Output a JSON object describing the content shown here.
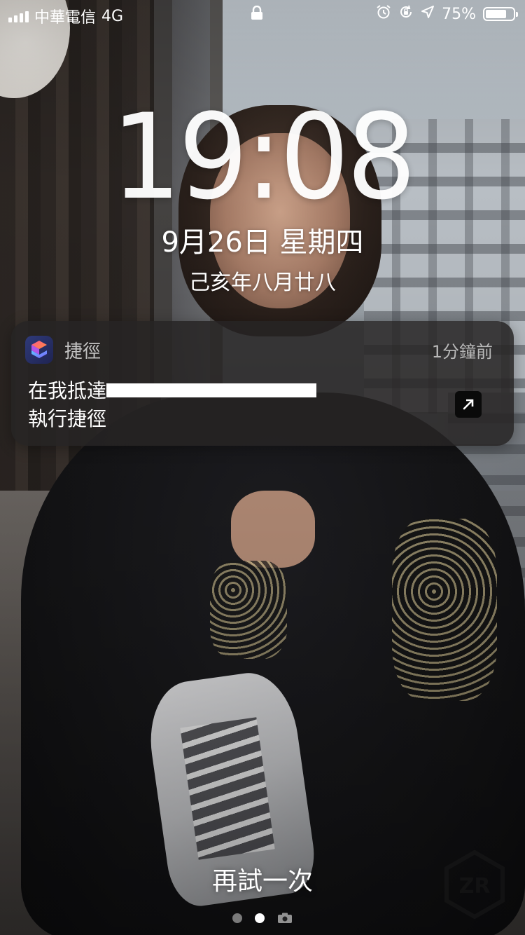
{
  "status_bar": {
    "carrier": "中華電信",
    "network": "4G",
    "battery_percent_label": "75%",
    "battery_level": 0.75,
    "icons": [
      "signal-icon",
      "lock-icon",
      "alarm-icon",
      "rotation-lock-icon",
      "location-icon",
      "battery-icon"
    ]
  },
  "lock_screen": {
    "time": "19:08",
    "date": "9月26日 星期四",
    "lunar_date": "己亥年八月廿八"
  },
  "notification": {
    "app_name": "捷徑",
    "time_ago": "1分鐘前",
    "title_prefix": "在我抵達",
    "body": "執行捷徑",
    "icons": [
      "shortcuts-app-icon",
      "open-arrow-icon"
    ]
  },
  "bottom": {
    "retry_label": "再試一次",
    "page_indicator": {
      "pages": 2,
      "current": 2,
      "has_camera_page": true
    }
  },
  "colors": {
    "notification_bg": "#262424",
    "text": "#ffffff",
    "secondary_text": "#b8b8b8"
  }
}
